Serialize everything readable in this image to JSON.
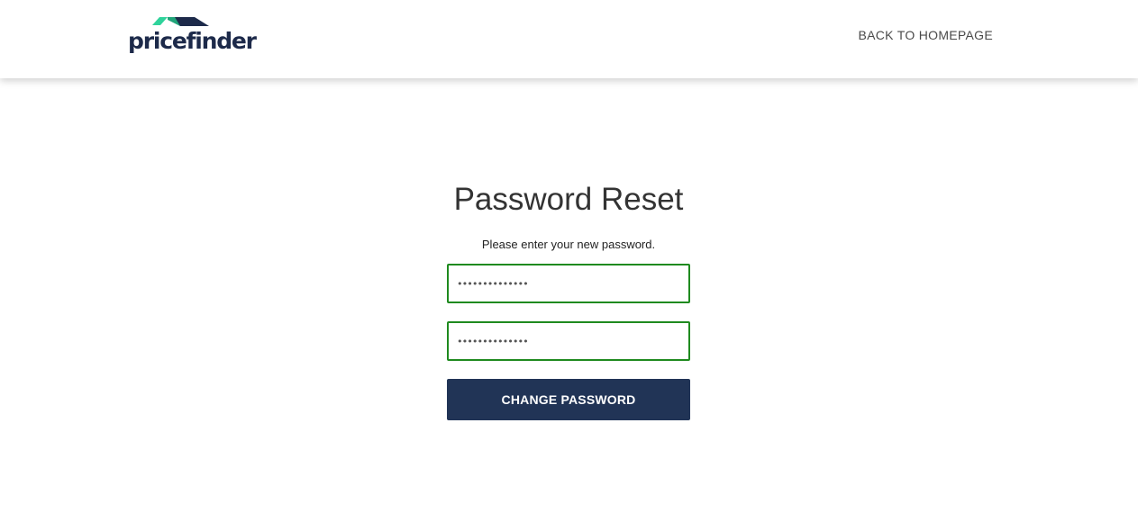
{
  "header": {
    "logo_text": "pricefinder",
    "back_link_label": "BACK TO HOMEPAGE"
  },
  "reset_form": {
    "title": "Password Reset",
    "instruction": "Please enter your new password.",
    "new_password_value": "••••••••••••••",
    "confirm_password_value": "••••••••••••••",
    "submit_label": "CHANGE PASSWORD"
  },
  "colors": {
    "brand_navy": "#213456",
    "brand_green": "#2fd39b",
    "valid_border": "#1f8a1f",
    "header_text": "#4a4a4a"
  },
  "icons": {
    "logo_mark": "roof-chevron-icon"
  }
}
